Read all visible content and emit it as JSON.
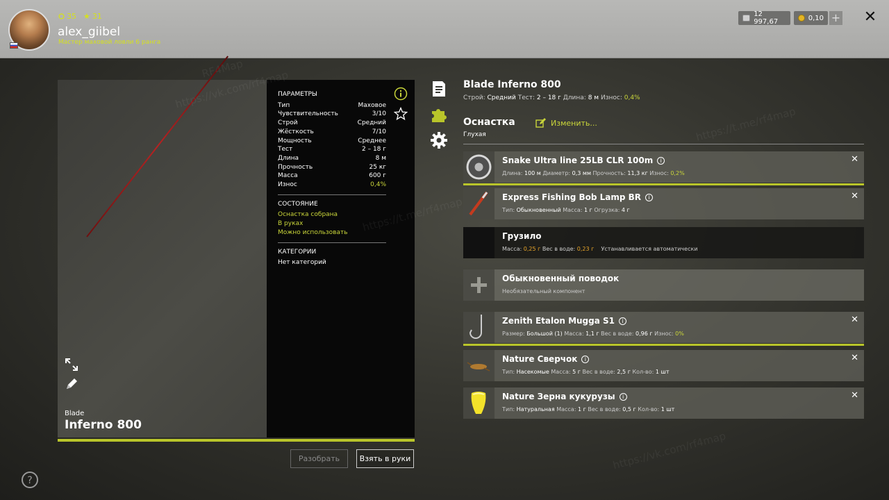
{
  "player": {
    "name": "alex_giibel",
    "rank": "Мастер маховой ловли 6 ранга",
    "level": "35",
    "stars": "31"
  },
  "wallet": {
    "silver": "12 997,67",
    "gold": "0,10",
    "add": "+"
  },
  "close": "✕",
  "rod": {
    "brand": "Blade",
    "model": "Inferno 800",
    "title": "Blade Inferno 800",
    "summary": {
      "build_label": "Строй:",
      "build": "Средний",
      "test_label": "Тест:",
      "test": "2 – 18 г",
      "length_label": "Длина:",
      "length": "8 м",
      "wear_label": "Износ:",
      "wear": "0,4%"
    }
  },
  "params": {
    "title": "ПАРАМЕТРЫ",
    "rows": [
      {
        "k": "Тип",
        "v": "Маховое"
      },
      {
        "k": "Чувствительность",
        "v": "3/10"
      },
      {
        "k": "Строй",
        "v": "Средний"
      },
      {
        "k": "Жёсткость",
        "v": "7/10"
      },
      {
        "k": "Мощность",
        "v": "Среднее"
      },
      {
        "k": "Тест",
        "v": "2 – 18 г"
      },
      {
        "k": "Длина",
        "v": "8 м"
      },
      {
        "k": "Прочность",
        "v": "25 кг"
      },
      {
        "k": "Масса",
        "v": "600 г"
      },
      {
        "k": "Износ",
        "v": "0,4%"
      }
    ],
    "state_title": "СОСТОЯНИЕ",
    "states": [
      "Оснастка собрана",
      "В руках",
      "Можно использовать"
    ],
    "cat_title": "КАТЕГОРИИ",
    "cat_value": "Нет категорий"
  },
  "buttons": {
    "disassemble": "Разобрать",
    "take": "Взять в руки"
  },
  "tackle": {
    "title": "Оснастка",
    "edit": "Изменить...",
    "type": "Глухая",
    "info_glyph": "i",
    "items": [
      {
        "name": "Snake Ultra line 25LB CLR 100m",
        "meta": [
          [
            "Длина:",
            "100 м"
          ],
          [
            "Диаметр:",
            "0,3 мм"
          ],
          [
            "Прочность:",
            "11,3 кг"
          ],
          [
            "Износ:",
            "0,2%"
          ]
        ]
      },
      {
        "name": "Express Fishing Bob Lamp BR",
        "meta": [
          [
            "Тип:",
            "Обыкновенный"
          ],
          [
            "Масса:",
            "1 г"
          ],
          [
            "Огрузка:",
            "4 г"
          ]
        ]
      },
      {
        "name": "Грузило",
        "meta": [
          [
            "Масса:",
            "0,25 г"
          ],
          [
            "Вес в воде:",
            "0,23 г"
          ]
        ],
        "note": "Устанавливается автоматически"
      },
      {
        "name": "Обыкновенный поводок",
        "note": "Необязательный компонент"
      },
      {
        "name": "Zenith Etalon Mugga S1",
        "meta": [
          [
            "Размер:",
            "Большой (1)"
          ],
          [
            "Масса:",
            "1,1 г"
          ],
          [
            "Вес в воде:",
            "0,96 г"
          ],
          [
            "Износ:",
            "0%"
          ]
        ]
      },
      {
        "name": "Nature Сверчок",
        "meta": [
          [
            "Тип:",
            "Насекомые"
          ],
          [
            "Масса:",
            "5 г"
          ],
          [
            "Вес в воде:",
            "2,5 г"
          ],
          [
            "Кол-во:",
            "1 шт"
          ]
        ]
      },
      {
        "name": "Nature Зерна кукурузы",
        "meta": [
          [
            "Тип:",
            "Натуральная"
          ],
          [
            "Масса:",
            "1 г"
          ],
          [
            "Вес в воде:",
            "0,5 г"
          ],
          [
            "Кол-во:",
            "1 шт"
          ]
        ]
      }
    ]
  },
  "colors": {
    "accent": "#c9d53a",
    "bar": "#b9c52a",
    "orange": "#e8a52a"
  },
  "watermark": [
    "RF4Map",
    "https://vk.com/rf4map",
    "https://t.me/rf4map"
  ]
}
